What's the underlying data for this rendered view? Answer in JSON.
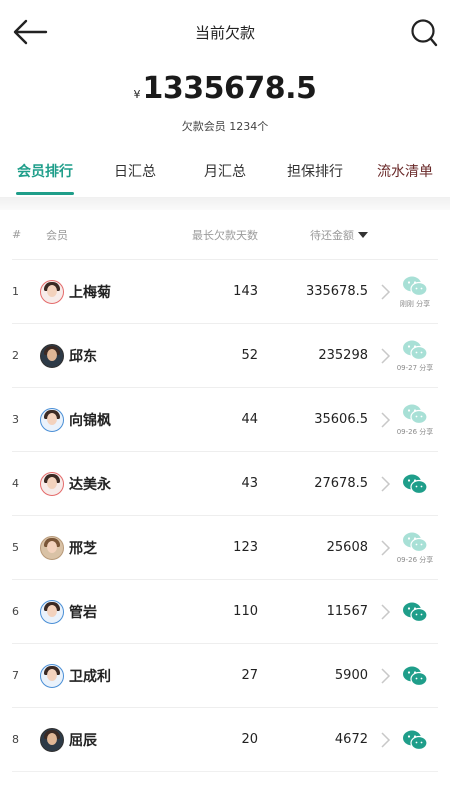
{
  "header": {
    "title": "当前欠款"
  },
  "summary": {
    "currency": "¥",
    "amount": "1335678.5",
    "members_label": "欠款会员 1234个"
  },
  "tabs": [
    {
      "label": "会员排行"
    },
    {
      "label": "日汇总"
    },
    {
      "label": "月汇总"
    },
    {
      "label": "担保排行"
    },
    {
      "label": "流水清单"
    }
  ],
  "table": {
    "headers": {
      "rank": "#",
      "member": "会员",
      "days": "最长欠款天数",
      "amount": "待还金额"
    },
    "rows": [
      {
        "rank": "1",
        "name": "上梅菊",
        "days": "143",
        "amount": "335678.5",
        "share": "刚刚 分享"
      },
      {
        "rank": "2",
        "name": "邱东",
        "days": "52",
        "amount": "235298",
        "share": "09-27 分享"
      },
      {
        "rank": "3",
        "name": "向锦枫",
        "days": "44",
        "amount": "35606.5",
        "share": "09-26 分享"
      },
      {
        "rank": "4",
        "name": "达美永",
        "days": "43",
        "amount": "27678.5",
        "share": ""
      },
      {
        "rank": "5",
        "name": "邢芝",
        "days": "123",
        "amount": "25608",
        "share": "09-26 分享"
      },
      {
        "rank": "6",
        "name": "管岩",
        "days": "110",
        "amount": "11567",
        "share": ""
      },
      {
        "rank": "7",
        "name": "卫成利",
        "days": "27",
        "amount": "5900",
        "share": ""
      },
      {
        "rank": "8",
        "name": "屈辰",
        "days": "20",
        "amount": "4672",
        "share": ""
      }
    ]
  },
  "colors": {
    "accent": "#1f9e8a",
    "wechat_shared": "#a8e0d6",
    "wechat_active": "#1f9e8a"
  },
  "icons": {
    "back": "arrow-left-icon",
    "search": "search-icon",
    "sort": "sort-down-icon",
    "row_action": "wechat-icon",
    "row_link": "chevron-right-icon"
  }
}
